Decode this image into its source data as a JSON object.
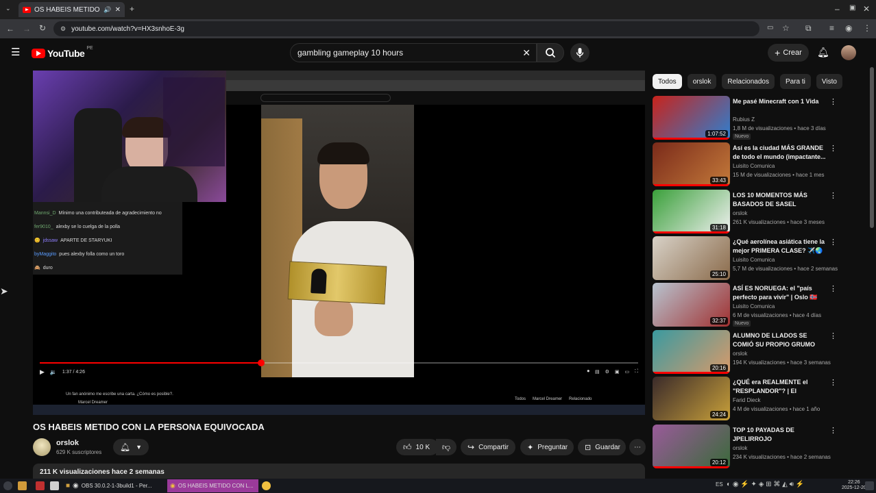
{
  "browser": {
    "tab_title": "OS HABEIS METIDO CO",
    "url": "youtube.com/watch?v=HX3snhoE-3g"
  },
  "youtube": {
    "logo_text": "YouTube",
    "country": "PE",
    "search_value": "gambling gameplay 10 hours",
    "create_label": "Crear"
  },
  "player": {
    "current_time": "1:37 / 4:26",
    "progress": 0.37,
    "chat": [
      {
        "user": "Mannsi_D",
        "message": "Mínimo una contributeada de agradecimiento no"
      },
      {
        "user": "fer9010_",
        "message": "alexby se lo cuelga de la polla"
      },
      {
        "user": "jdssaw",
        "message": "APARTE DE STARYUKI"
      },
      {
        "user": "byMaggito",
        "message": "pues alexby folla como un toro"
      },
      {
        "user": "",
        "message": "duro"
      }
    ],
    "nested_comment": "Un fan anónimo me escribe una carta. ¿Cómo es posible?.",
    "nested_channel": "Marcel Dreamer",
    "nested_chips": [
      "Todos",
      "Marcel Dreamer",
      "Relacionado"
    ]
  },
  "video": {
    "title": "OS HABEIS METIDO CON LA PERSONA EQUIVOCADA",
    "channel": "orslok",
    "subscribers": "629 K suscriptores",
    "likes": "10 K",
    "share_label": "Compartir",
    "ask_label": "Preguntar",
    "save_label": "Guardar",
    "description_meta": "211 K visualizaciones  hace 2 semanas"
  },
  "sidebar": {
    "chips": [
      "Todos",
      "orslok",
      "Relacionados",
      "Para ti",
      "Visto"
    ],
    "recommendations": [
      {
        "title": "Me pasé Minecraft con 1 Vida",
        "channel": "Rubius Z",
        "meta": "1,8 M de visualizaciones • hace 3 días",
        "badge": "Nuevo",
        "duration": "1:07:52",
        "colors": [
          "#c8231b",
          "#2e7fd0"
        ]
      },
      {
        "title": "Así es la ciudad MÁS GRANDE de todo el mundo (impactante...",
        "channel": "Luisito Comunica",
        "meta": "15 M de visualizaciones • hace 1 mes",
        "badge": "",
        "duration": "33:43",
        "colors": [
          "#7a2a1a",
          "#c47a3a"
        ]
      },
      {
        "title": "LOS 10 MOMENTOS MÁS BASADOS DE SASEL",
        "channel": "orslok",
        "meta": "261 K visualizaciones • hace 3 meses",
        "badge": "",
        "duration": "31:18",
        "colors": [
          "#3aa03a",
          "#f0f0f0"
        ]
      },
      {
        "title": "¿Qué aerolínea asiática tiene la mejor PRIMERA CLASE? ✈️🌏",
        "channel": "Luisito Comunica",
        "meta": "5,7 M de visualizaciones • hace 2 semanas",
        "badge": "",
        "duration": "25:10",
        "colors": [
          "#d8d2c8",
          "#8a6a4a"
        ]
      },
      {
        "title": "ASÍ ES NORUEGA: el \"país perfecto para vivir\" | Oslo 🇳🇴",
        "channel": "Luisito Comunica",
        "meta": "6 M de visualizaciones • hace 4 días",
        "badge": "Nuevo",
        "duration": "32:37",
        "colors": [
          "#b8c4d0",
          "#a03030"
        ]
      },
      {
        "title": "ALUMNO DE LLADOS SE COMIÓ SU PROPIO GRUMO",
        "channel": "orslok",
        "meta": "194 K visualizaciones • hace 3 semanas",
        "badge": "",
        "duration": "20:16",
        "colors": [
          "#3a9aa0",
          "#d89a6a"
        ]
      },
      {
        "title": "¿QUÉ era REALMENTE el \"RESPLANDOR\"? | El Resplandor...",
        "channel": "Farid Dieck",
        "meta": "4 M de visualizaciones • hace 1 año",
        "badge": "",
        "duration": "24:24",
        "colors": [
          "#3a2a2a",
          "#c8a03a"
        ]
      },
      {
        "title": "TOP 10 PAYADAS DE JPELIRROJO",
        "channel": "orslok",
        "meta": "234 K visualizaciones • hace 2 semanas",
        "badge": "",
        "duration": "20:12",
        "colors": [
          "#9a5a9a",
          "#3a6a3a"
        ]
      }
    ]
  },
  "taskbar": {
    "obs_label": "OBS 30.0.2-1-3build1 - Per...",
    "chrome_label": "OS HABEIS METIDO CON L...",
    "time": "22:26",
    "date": "2025-12-20"
  }
}
